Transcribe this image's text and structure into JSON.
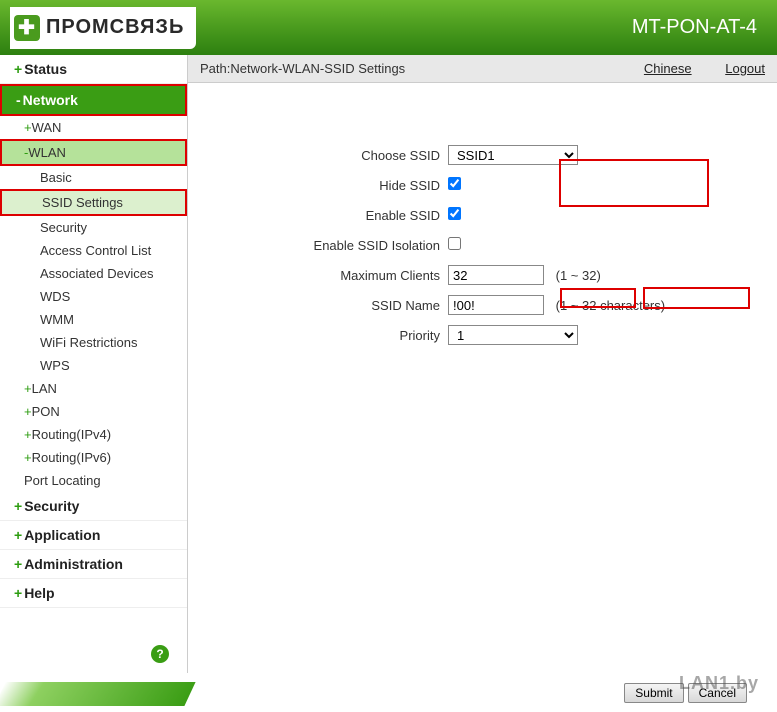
{
  "header": {
    "brand": "ПРОМСВЯЗЬ",
    "model": "MT-PON-AT-4"
  },
  "pathbar": {
    "label": "Path:Network-WLAN-SSID Settings",
    "lang_link": "Chinese",
    "logout": "Logout"
  },
  "nav": {
    "status": "Status",
    "network": "Network",
    "wan": "WAN",
    "wlan": "WLAN",
    "wlan_children": {
      "basic": "Basic",
      "ssid_settings": "SSID Settings",
      "security": "Security",
      "acl": "Access Control List",
      "assoc": "Associated Devices",
      "wds": "WDS",
      "wmm": "WMM",
      "wifi_restrict": "WiFi Restrictions",
      "wps": "WPS"
    },
    "lan": "LAN",
    "pon": "PON",
    "routing4": "Routing(IPv4)",
    "routing6": "Routing(IPv6)",
    "port_locating": "Port Locating",
    "security": "Security",
    "application": "Application",
    "administration": "Administration",
    "help": "Help"
  },
  "form": {
    "choose_ssid_label": "Choose SSID",
    "choose_ssid_value": "SSID1",
    "hide_ssid_label": "Hide SSID",
    "hide_ssid_checked": true,
    "enable_ssid_label": "Enable SSID",
    "enable_ssid_checked": true,
    "isolation_label": "Enable SSID Isolation",
    "isolation_checked": false,
    "max_clients_label": "Maximum Clients",
    "max_clients_value": "32",
    "max_clients_hint": "(1 ~ 32)",
    "ssid_name_label": "SSID Name",
    "ssid_name_value": "!00!",
    "ssid_name_hint": "(1 ~ 32 characters)",
    "priority_label": "Priority",
    "priority_value": "1"
  },
  "footer": {
    "submit": "Submit",
    "cancel": "Cancel"
  },
  "watermark": "LAN1.by"
}
